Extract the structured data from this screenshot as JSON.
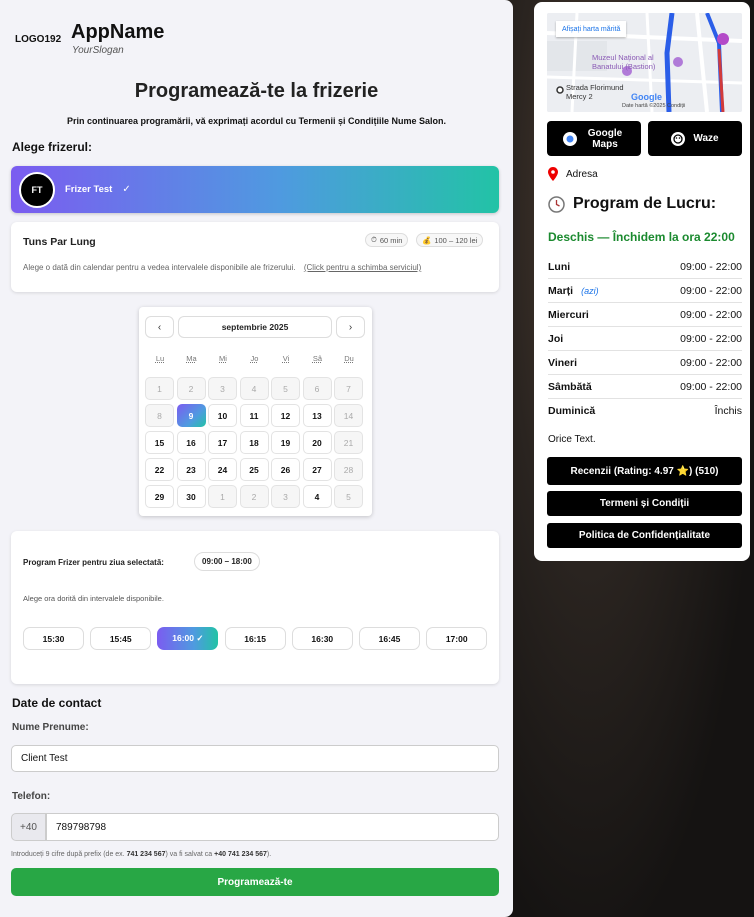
{
  "header": {
    "logo": "LOGO192",
    "app_name": "AppName",
    "slogan": "YourSlogan"
  },
  "page": {
    "title": "Programează-te la frizerie",
    "consent": "Prin continuarea programării, vă exprimați acordul cu Termenii și Condițiile Nume Salon."
  },
  "barber_section": {
    "title": "Alege frizerul:",
    "barber": {
      "initials": "FT",
      "name": "Frizer Test",
      "check": "✓"
    }
  },
  "service": {
    "name": "Tuns Par Lung",
    "duration": "60 min",
    "price": "100 – 120 lei",
    "hint": "Alege o dată din calendar pentru a vedea intervalele disponibile ale frizerului.",
    "change_link": "(Click pentru a schimba serviciul)"
  },
  "calendar": {
    "prev": "‹",
    "next": "›",
    "month": "septembrie 2025",
    "weekdays": [
      "Lu",
      "Ma",
      "Mi",
      "Jo",
      "Vi",
      "Sâ",
      "Du"
    ],
    "weeks": [
      [
        {
          "d": "1",
          "s": "muted"
        },
        {
          "d": "2",
          "s": "muted"
        },
        {
          "d": "3",
          "s": "muted"
        },
        {
          "d": "4",
          "s": "muted"
        },
        {
          "d": "5",
          "s": "muted"
        },
        {
          "d": "6",
          "s": "muted"
        },
        {
          "d": "7",
          "s": "muted"
        }
      ],
      [
        {
          "d": "8",
          "s": "muted"
        },
        {
          "d": "9",
          "s": "sel"
        },
        {
          "d": "10",
          "s": ""
        },
        {
          "d": "11",
          "s": ""
        },
        {
          "d": "12",
          "s": ""
        },
        {
          "d": "13",
          "s": ""
        },
        {
          "d": "14",
          "s": "muted"
        }
      ],
      [
        {
          "d": "15",
          "s": ""
        },
        {
          "d": "16",
          "s": ""
        },
        {
          "d": "17",
          "s": ""
        },
        {
          "d": "18",
          "s": ""
        },
        {
          "d": "19",
          "s": ""
        },
        {
          "d": "20",
          "s": ""
        },
        {
          "d": "21",
          "s": "muted"
        }
      ],
      [
        {
          "d": "22",
          "s": ""
        },
        {
          "d": "23",
          "s": ""
        },
        {
          "d": "24",
          "s": ""
        },
        {
          "d": "25",
          "s": ""
        },
        {
          "d": "26",
          "s": ""
        },
        {
          "d": "27",
          "s": ""
        },
        {
          "d": "28",
          "s": "muted"
        }
      ],
      [
        {
          "d": "29",
          "s": ""
        },
        {
          "d": "30",
          "s": ""
        },
        {
          "d": "1",
          "s": "muted"
        },
        {
          "d": "2",
          "s": "muted"
        },
        {
          "d": "3",
          "s": "muted"
        },
        {
          "d": "4",
          "s": ""
        },
        {
          "d": "5",
          "s": "muted"
        }
      ]
    ]
  },
  "hours": {
    "label": "Program Frizer pentru ziua selectată:",
    "range": "09:00 – 18:00",
    "hint": "Alege ora dorită din intervalele disponibile.",
    "slots": [
      {
        "label": "15:30",
        "selected": false
      },
      {
        "label": "15:45",
        "selected": false
      },
      {
        "label": "16:00 ✓",
        "selected": true
      },
      {
        "label": "16:15",
        "selected": false
      },
      {
        "label": "16:30",
        "selected": false
      },
      {
        "label": "16:45",
        "selected": false
      },
      {
        "label": "17:00",
        "selected": false
      }
    ]
  },
  "contact": {
    "title": "Date de contact",
    "name_label": "Nume Prenume:",
    "name_value": "Client Test",
    "phone_label": "Telefon:",
    "phone_prefix": "+40",
    "phone_value": "789798798",
    "phone_hint_a": "Introduceți 9 cifre după prefix (de ex. ",
    "phone_hint_example": "741 234 567",
    "phone_hint_b": ") va fi salvat ca ",
    "phone_hint_saved": "+40 741 234 567",
    "phone_hint_c": ").",
    "submit": "Programează-te"
  },
  "map": {
    "open_larger": "Afișați harta mărită",
    "museum": "Muzeul Național al Banatului (Bastion)",
    "street": "Strada Florimund Mercy 2",
    "google": "Google",
    "footer": "Date hartă ©2025   Condiții"
  },
  "nav": {
    "google_maps": "Google Maps",
    "waze": "Waze"
  },
  "address": "Adresa",
  "schedule": {
    "title": "Program de Lucru:",
    "status": "Deschis — Închidem la ora 22:00",
    "today_label": "(azi)",
    "days": [
      {
        "name": "Luni",
        "hours": "09:00 - 22:00",
        "today": false
      },
      {
        "name": "Marți",
        "hours": "09:00 - 22:00",
        "today": true
      },
      {
        "name": "Miercuri",
        "hours": "09:00 - 22:00",
        "today": false
      },
      {
        "name": "Joi",
        "hours": "09:00 - 22:00",
        "today": false
      },
      {
        "name": "Vineri",
        "hours": "09:00 - 22:00",
        "today": false
      },
      {
        "name": "Sâmbătă",
        "hours": "09:00 - 22:00",
        "today": false
      },
      {
        "name": "Duminică",
        "hours": "Închis",
        "today": false
      }
    ]
  },
  "extra_text": "Orice Text.",
  "buttons": {
    "reviews": "Recenzii (Rating: 4.97 ⭐) (510)",
    "terms": "Termeni și Condiții",
    "privacy": "Politica de Confidențialitate"
  },
  "colors": {
    "accent_start": "#7b5cf0",
    "accent_end": "#22c3a6",
    "submit": "#28a745",
    "open": "#1b8a2f"
  }
}
